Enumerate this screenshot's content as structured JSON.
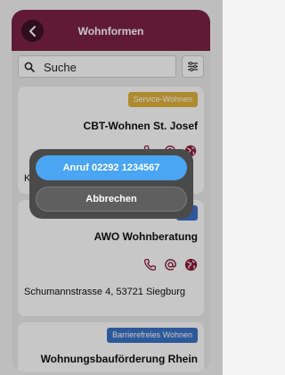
{
  "header": {
    "title": "Wohnformen",
    "back_icon": "chevron-left-icon"
  },
  "search": {
    "placeholder": "Suche",
    "icon": "search-icon",
    "filter_icon": "sliders-icon"
  },
  "cards": [
    {
      "badge": "Service-Wohnen",
      "badge_color": "#e0b33d",
      "title": "CBT-Wohnen St. Josef",
      "address": "K"
    },
    {
      "badge": "",
      "badge_color": "#3a72c6",
      "title": "AWO Wohnberatung",
      "address": "Schumannstrasse 4, 53721 Siegburg"
    },
    {
      "badge": "Barrierefreies Wohnen",
      "badge_color": "#3a72c6",
      "title": "Wohnungsbauförderung Rhein"
    }
  ],
  "colors": {
    "accent": "#7d2246",
    "call": "#4aa5f2"
  },
  "dialog": {
    "call_label": "Anruf 02292 1234567",
    "cancel_label": "Abbrechen"
  }
}
